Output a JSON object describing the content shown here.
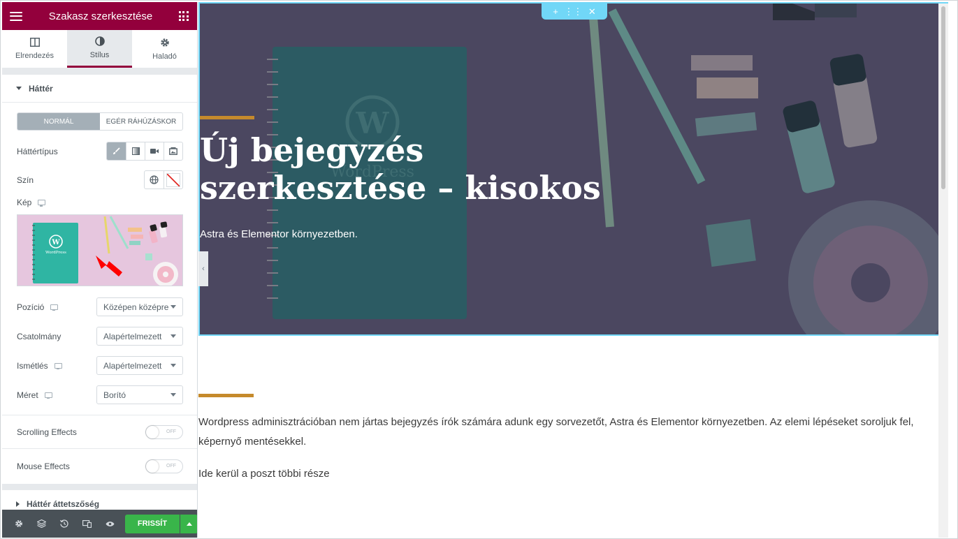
{
  "panel": {
    "header": {
      "title": "Szakasz szerkesztése"
    },
    "tabs": [
      {
        "label": "Elrendezés",
        "icon": "columns-icon"
      },
      {
        "label": "Stílus",
        "icon": "contrast-icon",
        "active": true
      },
      {
        "label": "Haladó",
        "icon": "gear-icon"
      }
    ],
    "section": {
      "title": "Háttér",
      "state_normal": "Normál",
      "state_hover": "Egér ráhúzáskor",
      "bg_type_label": "Háttértípus",
      "color_label": "Szín",
      "image_label": "Kép",
      "position": {
        "label": "Pozíció",
        "value": "Középen középre"
      },
      "attachment": {
        "label": "Csatolmány",
        "value": "Alapértelmezett"
      },
      "repeat": {
        "label": "Ismétlés",
        "value": "Alapértelmezett"
      },
      "size": {
        "label": "Méret",
        "value": "Borító"
      },
      "scrolling": {
        "label": "Scrolling Effects",
        "state": "OFF"
      },
      "mouse": {
        "label": "Mouse Effects",
        "state": "OFF"
      },
      "next_section": "Háttér áttetszőség",
      "preview_logo": "WordPress"
    },
    "footer": {
      "update": "FRISSÍT"
    }
  },
  "preview": {
    "hero": {
      "logo_text": "WordPress",
      "title_line1": "Új bejegyzés",
      "title_line2": "szerkesztése – kisokos",
      "subtitle": "Astra és Elementor környezetben."
    },
    "body": {
      "paragraph": "Wordpress adminisztrációban nem jártas bejegyzés írók számára adunk egy sorvezetőt, Astra és Elementor környezetben. Az elemi lépéseket soroljuk fel, képernyő mentésekkel.",
      "paragraph2": "Ide kerül a poszt többi része"
    }
  },
  "colors": {
    "brand": "#93003c",
    "accent_rule": "#c58a2c",
    "selection": "#71d7f7",
    "update_button": "#39b54a"
  }
}
